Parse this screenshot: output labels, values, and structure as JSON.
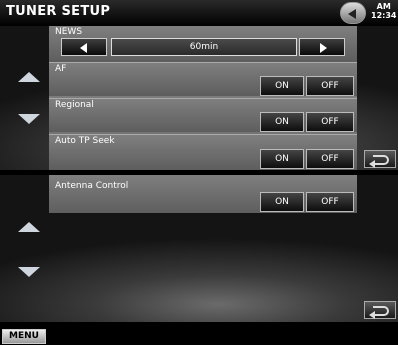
{
  "header": {
    "title": "TUNER SETUP",
    "clock_period": "AM",
    "clock_time": "12:34"
  },
  "top_panel": {
    "news": {
      "label": "NEWS",
      "value": "60min"
    },
    "rows": [
      {
        "label": "AF",
        "on": "ON",
        "off": "OFF"
      },
      {
        "label": "Regional",
        "on": "ON",
        "off": "OFF"
      },
      {
        "label": "Auto TP Seek",
        "on": "ON",
        "off": "OFF"
      }
    ]
  },
  "bottom_panel": {
    "rows": [
      {
        "label": "Antenna Control",
        "on": "ON",
        "off": "OFF"
      }
    ]
  },
  "footer": {
    "menu_label": "MENU"
  },
  "icons": {
    "clock_button": "back-arrow-circle-icon",
    "scroll_up": "scroll-up-icon",
    "scroll_down": "scroll-down-icon",
    "return": "return-icon"
  },
  "colors": {
    "row_bg": "#6f6f6f",
    "button_bg": "#1a1a1a",
    "scroll_arrow": "#cfd6de"
  }
}
